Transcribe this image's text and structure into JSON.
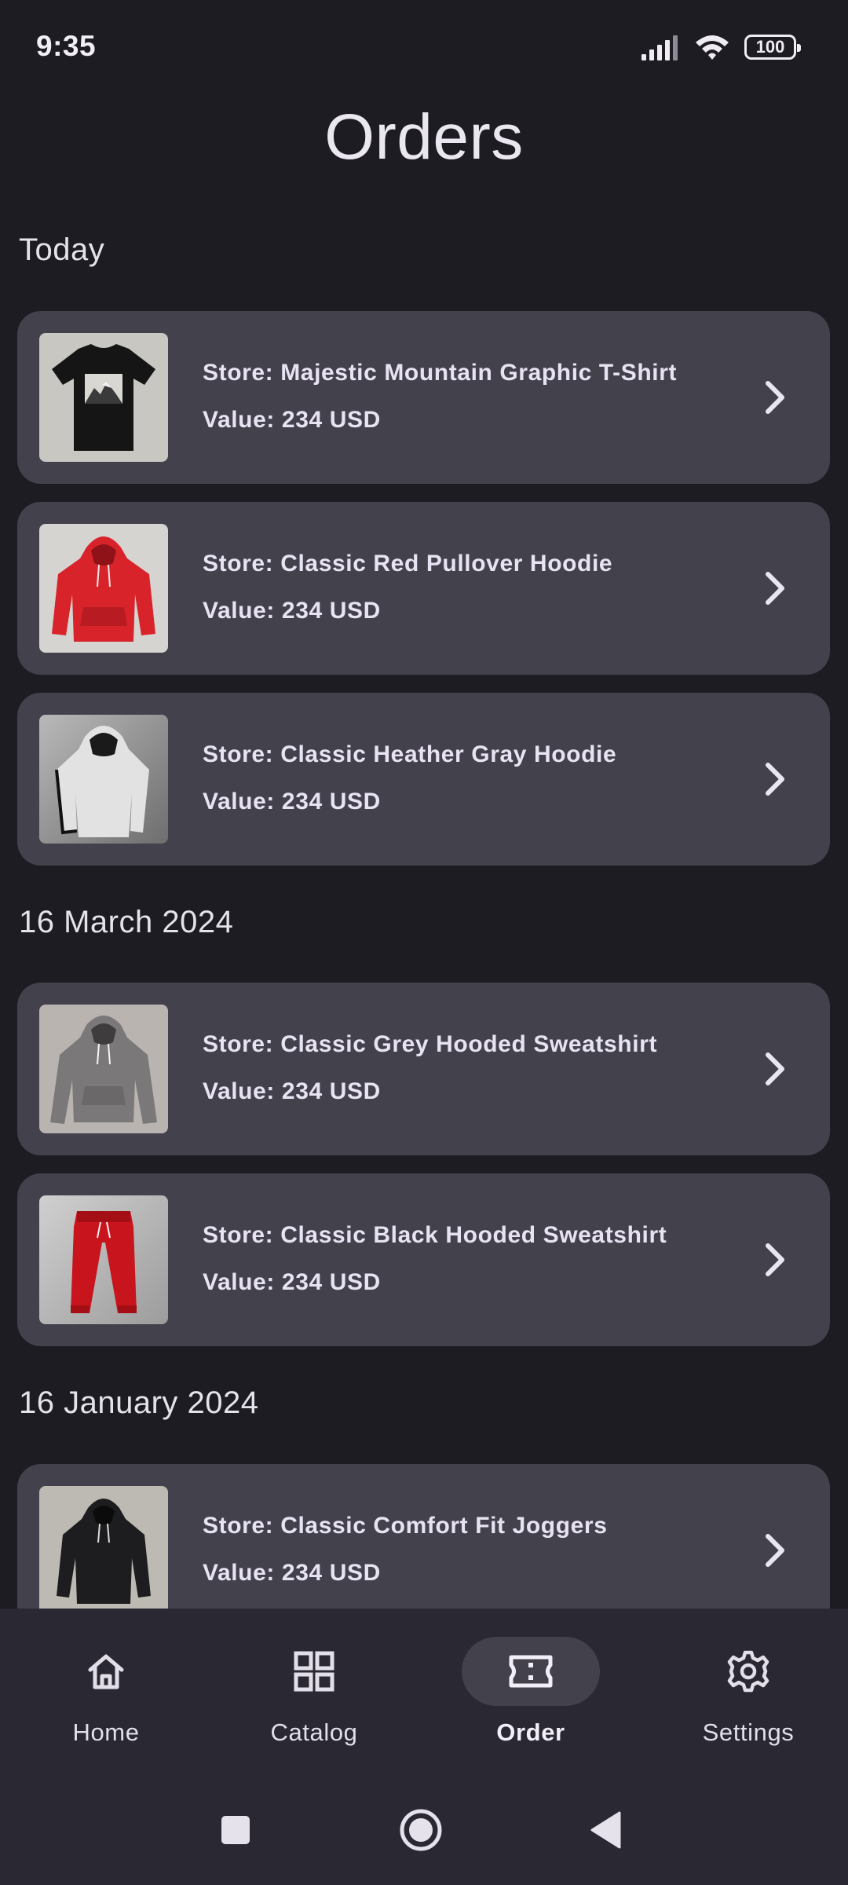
{
  "status_bar": {
    "time": "9:35",
    "battery": "100"
  },
  "header": {
    "title": "Orders"
  },
  "sections": [
    {
      "label": "Today"
    },
    {
      "label": "16 March 2024"
    },
    {
      "label": "16 January 2024"
    }
  ],
  "orders": [
    {
      "store": "Store: Majestic Mountain Graphic T-Shirt",
      "value": "Value: 234 USD"
    },
    {
      "store": "Store: Classic Red Pullover Hoodie",
      "value": "Value: 234 USD"
    },
    {
      "store": "Store: Classic Heather Gray Hoodie",
      "value": "Value: 234 USD"
    },
    {
      "store": "Store: Classic Grey Hooded Sweatshirt",
      "value": "Value: 234 USD"
    },
    {
      "store": "Store: Classic Black Hooded Sweatshirt",
      "value": "Value: 234 USD"
    },
    {
      "store": "Store: Classic Comfort Fit Joggers",
      "value": "Value: 234 USD"
    }
  ],
  "bottom_nav": {
    "items": [
      {
        "label": "Home",
        "icon": "home-icon"
      },
      {
        "label": "Catalog",
        "icon": "grid-icon"
      },
      {
        "label": "Order",
        "icon": "ticket-icon",
        "active": true
      },
      {
        "label": "Settings",
        "icon": "gear-icon"
      }
    ]
  },
  "system_nav": {
    "icons": [
      "recents-icon",
      "home-circle-icon",
      "back-icon"
    ]
  },
  "colors": {
    "background": "#1d1c22",
    "card": "#43414c",
    "nav_background": "#292833",
    "text": "#e8e3f2"
  }
}
